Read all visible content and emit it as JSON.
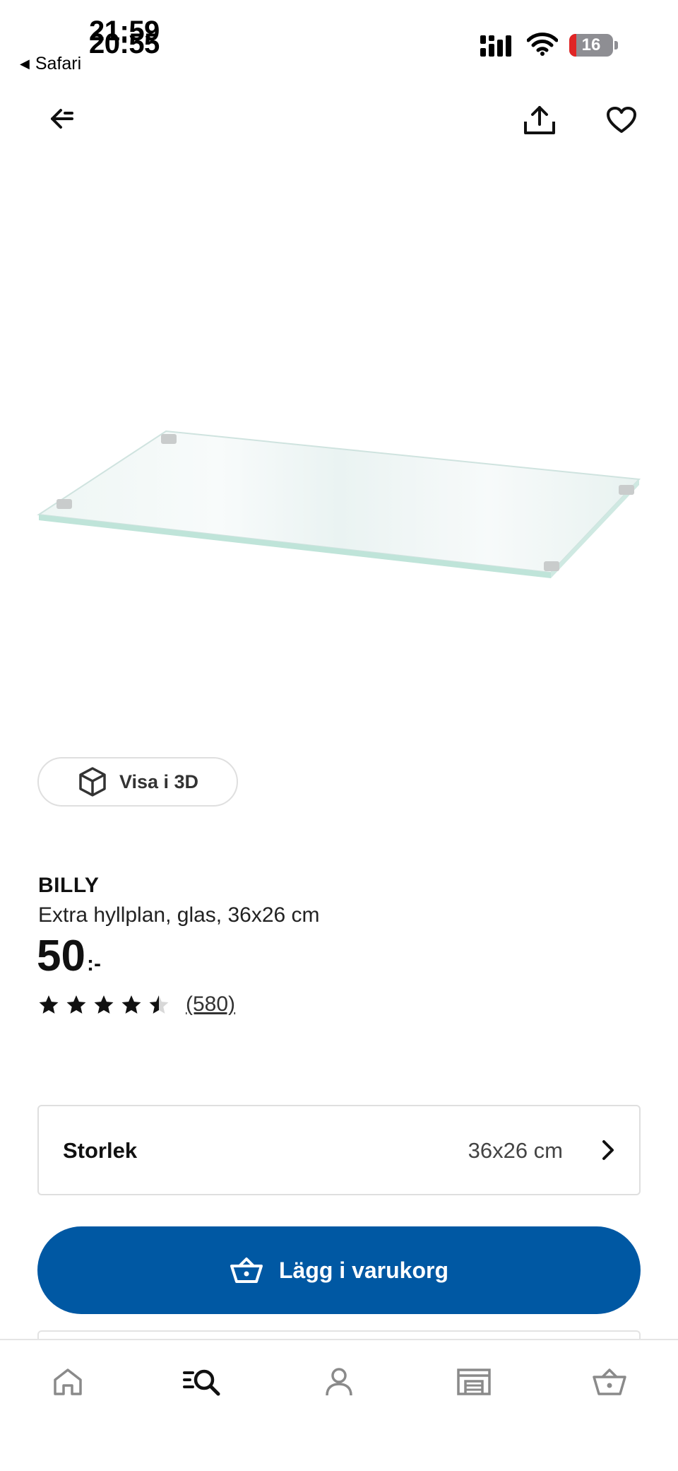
{
  "status_bar": {
    "time_primary": "21:59",
    "time_secondary": "20:55",
    "back_app": "Safari",
    "battery": "16",
    "battery_level": 0.16
  },
  "toolbar": {
    "back_icon": "back-arrow-icon",
    "share_icon": "share-icon",
    "favorite_icon": "heart-icon"
  },
  "product": {
    "image_icon": "glass-shelf-image",
    "view_3d_label": "Visa i 3D",
    "brand": "BILLY",
    "description": "Extra hyllplan, glas, 36x26 cm",
    "price": "50",
    "price_suffix": ":-",
    "rating": 4.5,
    "rating_count": "(580)"
  },
  "size_selector": {
    "label": "Storlek",
    "value": "36x26 cm"
  },
  "cart_button": {
    "label": "Lägg i varukorg"
  },
  "bottom_nav": {
    "items": [
      "home-icon",
      "search-icon",
      "profile-icon",
      "store-icon",
      "cart-icon"
    ]
  },
  "colors": {
    "accent": "#0058a3",
    "border": "#dfdfdf",
    "battery_low": "#e02525"
  }
}
